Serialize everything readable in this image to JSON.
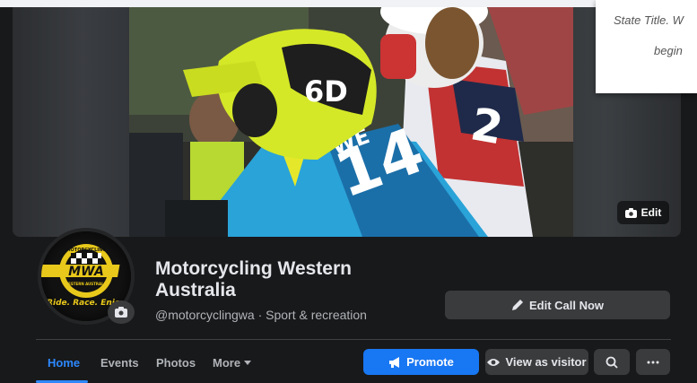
{
  "quote_card": {
    "line1": "State Title. W",
    "line2": "begin"
  },
  "cover": {
    "edit_label": "Edit"
  },
  "profile": {
    "name": "Motorcycling Western Australia",
    "handle": "@motorcyclingwa · Sport & recreation",
    "logo_text_top": "MOTORCYCLING",
    "logo_text_mid": "MWA",
    "logo_text_bottom": "WESTERN AUSTRALIA",
    "logo_slogan": "Ride. Race. Enjoy"
  },
  "actions": {
    "edit_call_now": "Edit Call Now",
    "promote": "Promote",
    "view_as_visitor": "View as visitor"
  },
  "tabs": [
    {
      "label": "Home",
      "active": true
    },
    {
      "label": "Events",
      "active": false
    },
    {
      "label": "Photos",
      "active": false
    },
    {
      "label": "More",
      "active": false
    }
  ],
  "colors": {
    "background": "#18191a",
    "accent": "#1877f2",
    "active_tab": "#2d88ff",
    "button_gray": "#3a3b3c"
  }
}
